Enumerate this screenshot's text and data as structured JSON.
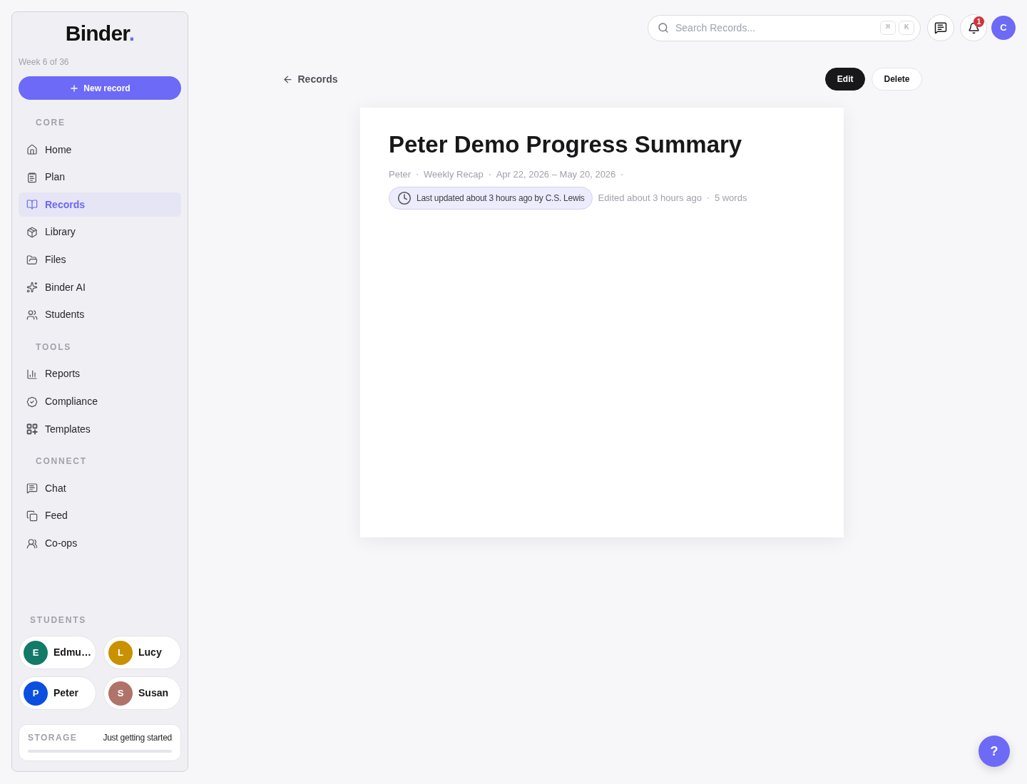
{
  "sidebar": {
    "logo": {
      "text": "Binder",
      "mark": "."
    },
    "week": "Week 6 of 36",
    "new_record_button": "New record",
    "sections": [
      {
        "title": "CORE",
        "items": [
          {
            "label": "Home",
            "selected": false
          },
          {
            "label": "Plan",
            "selected": false
          },
          {
            "label": "Records",
            "selected": true
          },
          {
            "label": "Library",
            "selected": false
          },
          {
            "label": "Files",
            "selected": false
          },
          {
            "label": "Binder AI",
            "selected": false
          },
          {
            "label": "Students",
            "selected": false
          }
        ]
      },
      {
        "title": "TOOLS",
        "items": [
          {
            "label": "Reports",
            "selected": false
          },
          {
            "label": "Compliance",
            "selected": false
          },
          {
            "label": "Templates",
            "selected": false
          }
        ]
      },
      {
        "title": "CONNECT",
        "items": [
          {
            "label": "Chat",
            "selected": false
          },
          {
            "label": "Feed",
            "selected": false
          },
          {
            "label": "Co-ops",
            "selected": false
          }
        ]
      }
    ],
    "students": {
      "title": "STUDENTS",
      "items": [
        {
          "initial": "E",
          "name": "Edmu…",
          "color": "#137a68"
        },
        {
          "initial": "L",
          "name": "Lucy",
          "color": "#c99100"
        },
        {
          "initial": "P",
          "name": "Peter",
          "color": "#0a4fe0"
        },
        {
          "initial": "S",
          "name": "Susan",
          "color": "#b0736a"
        }
      ]
    },
    "storage": {
      "label": "STORAGE",
      "status": "Just getting started"
    }
  },
  "top_bar": {
    "search": {
      "placeholder": "Search Records...",
      "keys": [
        "⌘",
        "K"
      ]
    },
    "notifications": {
      "count": "1"
    },
    "avatar": {
      "initial": "C"
    }
  },
  "toolbar": {
    "back_link": "Records",
    "actions": [
      {
        "label": "Edit",
        "kind": "primary"
      },
      {
        "label": "Delete",
        "kind": "secondary"
      }
    ]
  },
  "record": {
    "title": "Peter Demo Progress Summary",
    "meta": [
      "Peter",
      "Weekly Recap",
      "Apr 22, 2026 – May 20, 2026"
    ],
    "last_updated": "Last updated about 3 hours ago by C.S. Lewis",
    "edited": "Edited about 3 hours ago",
    "word_count": "5 words"
  },
  "help_button": "?"
}
